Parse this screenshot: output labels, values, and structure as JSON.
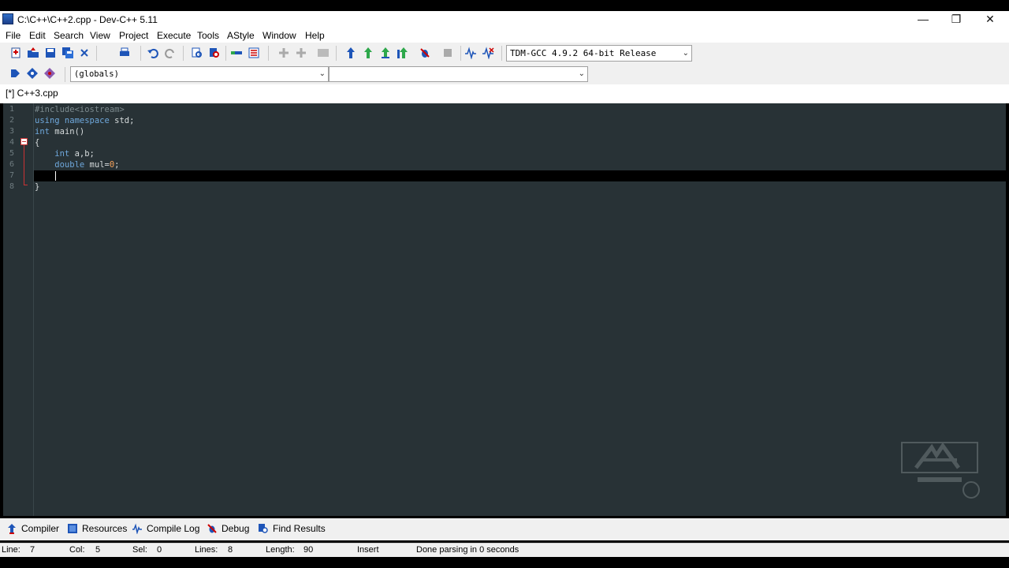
{
  "window": {
    "title": "C:\\C++\\C++2.cpp - Dev-C++ 5.11",
    "minimize_glyph": "—",
    "restore_glyph": "❐",
    "close_glyph": "✕"
  },
  "menu": [
    "File",
    "Edit",
    "Search",
    "View",
    "Project",
    "Execute",
    "Tools",
    "AStyle",
    "Window",
    "Help"
  ],
  "toolbar": {
    "compiler_select": "TDM-GCC 4.9.2 64-bit Release",
    "scope_select": "(globals)",
    "member_select": ""
  },
  "tabs": {
    "active": "[*] C++3.cpp"
  },
  "editor": {
    "line_numbers": [
      "1",
      "2",
      "3",
      "4",
      "5",
      "6",
      "7",
      "8"
    ],
    "lines": [
      [
        {
          "t": "#include<iostream>",
          "c": "pp"
        }
      ],
      [
        {
          "t": "using namespace ",
          "c": "kw"
        },
        {
          "t": "std;",
          "c": ""
        }
      ],
      [
        {
          "t": "int ",
          "c": "kw"
        },
        {
          "t": "main()",
          "c": ""
        }
      ],
      [
        {
          "t": "{",
          "c": ""
        }
      ],
      [
        {
          "t": "    int ",
          "c": "kw"
        },
        {
          "t": "a,b;",
          "c": ""
        }
      ],
      [
        {
          "t": "    double ",
          "c": "kw"
        },
        {
          "t": "mul=",
          "c": ""
        },
        {
          "t": "0",
          "c": "num"
        },
        {
          "t": ";",
          "c": ""
        }
      ],
      [
        {
          "t": "    ",
          "c": ""
        }
      ],
      [
        {
          "t": "}",
          "c": ""
        }
      ]
    ],
    "current_line": 7
  },
  "bottom_tabs": [
    "Compiler",
    "Resources",
    "Compile Log",
    "Debug",
    "Find Results"
  ],
  "status": {
    "line_label": "Line:",
    "line_value": "7",
    "col_label": "Col:",
    "col_value": "5",
    "sel_label": "Sel:",
    "sel_value": "0",
    "lines_label": "Lines:",
    "lines_value": "8",
    "length_label": "Length:",
    "length_value": "90",
    "mode": "Insert",
    "message": "Done parsing in 0 seconds"
  },
  "colors": {
    "editor_bg": "#283236",
    "current_line_bg": "#000000",
    "keyword": "#6fa8dc",
    "number": "#f6a25a"
  }
}
